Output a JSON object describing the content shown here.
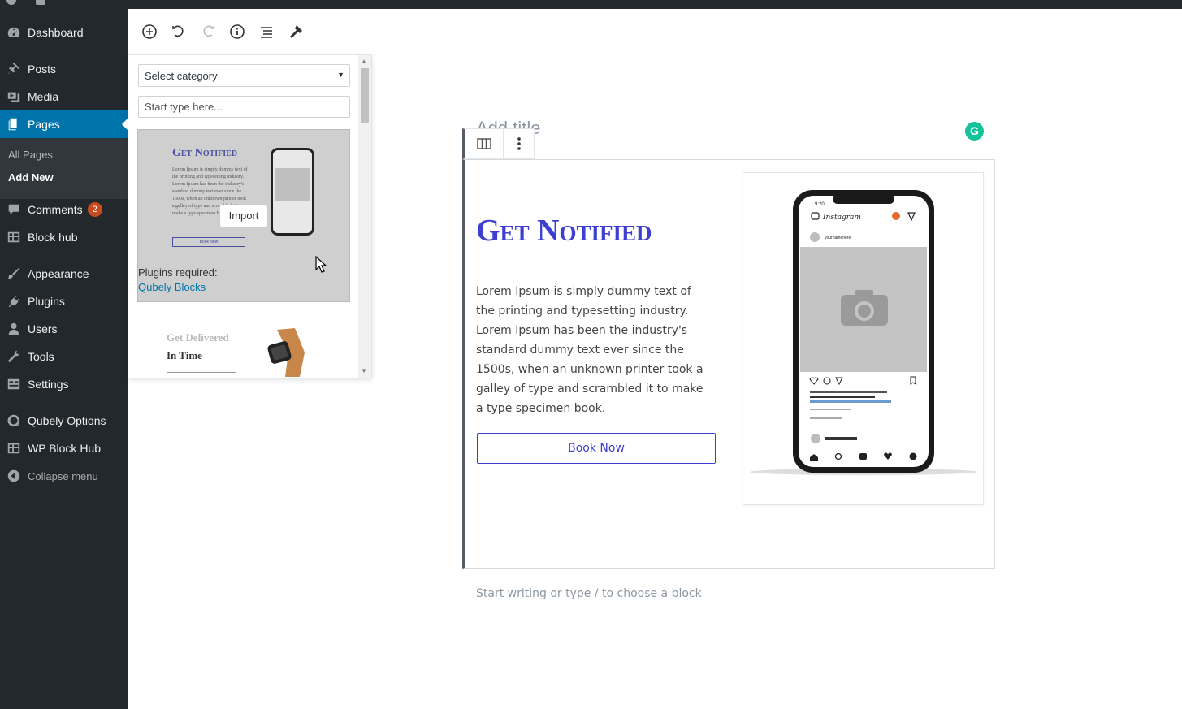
{
  "sidebar": {
    "dashboard": "Dashboard",
    "posts": "Posts",
    "media": "Media",
    "pages": "Pages",
    "all_pages": "All Pages",
    "add_new": "Add New",
    "comments": "Comments",
    "comments_count": "2",
    "block_hub": "Block hub",
    "appearance": "Appearance",
    "plugins": "Plugins",
    "users": "Users",
    "tools": "Tools",
    "settings": "Settings",
    "qubely_options": "Qubely Options",
    "wp_block_hub": "WP Block Hub",
    "collapse": "Collapse menu"
  },
  "library": {
    "category_placeholder": "Select category",
    "search_placeholder": "Start type here...",
    "card1": {
      "title": "Get Notified",
      "text": "Lorem Ipsum is simply dummy text of the printing and typesetting industry. Lorem Ipsum has been the industry's standard dummy text ever since the 1500s, when an unknown printer took a galley of type and scrambled it to make a type specimen book.",
      "button": "Book Now",
      "import_label": "Import",
      "plugins_required": "Plugins required:",
      "plugin_link": "Qubely Blocks"
    },
    "card2": {
      "title": "Get Delivered",
      "subtitle": "In Time"
    }
  },
  "editor": {
    "title_placeholder": "Add title",
    "heading": "Get Notified",
    "body": "Lorem Ipsum is simply dummy text of the printing and typesetting industry. Lorem Ipsum has been the industry's standard dummy text ever since the 1500s, when an unknown printer took a galley of type and scrambled it to make a type specimen book.",
    "button": "Book Now",
    "block_placeholder": "Start writing or type / to choose a block",
    "grammarly_letter": "G"
  },
  "phone": {
    "app_name": "Instagram",
    "username": "yournamehere",
    "time": "9:20"
  },
  "colors": {
    "sidebar_bg": "#23282d",
    "active_menu": "#0073aa",
    "accent_blue": "#3c3fd0",
    "badge": "#ca4a1f",
    "grammarly": "#15c39a"
  }
}
